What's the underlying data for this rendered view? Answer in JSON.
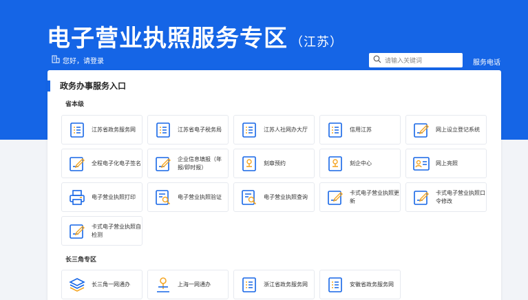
{
  "header": {
    "title": "电子营业执照服务专区",
    "subtitle": "（江苏）",
    "login_text": "您好，请登录",
    "hotline": "服务电话"
  },
  "search": {
    "placeholder": "请输入关键词"
  },
  "panel": {
    "title": "政务办事服务入口",
    "sections": [
      {
        "label": "省本级",
        "cards": [
          {
            "label": "江苏省政务服务网",
            "icon": "list-doc-icon"
          },
          {
            "label": "江苏省电子税务局",
            "icon": "list-doc-icon"
          },
          {
            "label": "江苏人社网办大厅",
            "icon": "list-doc-icon"
          },
          {
            "label": "信用江苏",
            "icon": "list-doc-icon"
          },
          {
            "label": "网上设立登记系统",
            "icon": "edit-doc-icon"
          },
          {
            "label": "全程电子化电子签名",
            "icon": "edit-doc-icon"
          },
          {
            "label": "企业信息填报（年报/即时报）",
            "icon": "edit-doc-icon"
          },
          {
            "label": "刻章预约",
            "icon": "stamp-doc-icon"
          },
          {
            "label": "刻企中心",
            "icon": "stamp-doc-icon"
          },
          {
            "label": "网上亮照",
            "icon": "id-card-icon"
          },
          {
            "label": "电子营业执照打印",
            "icon": "printer-icon"
          },
          {
            "label": "电子营业执照验证",
            "icon": "search-doc-icon"
          },
          {
            "label": "电子营业执照查询",
            "icon": "search-doc-icon"
          },
          {
            "label": "卡式电子营业执照更新",
            "icon": "edit-doc-icon"
          },
          {
            "label": "卡式电子营业执照口令修改",
            "icon": "edit-doc-icon"
          },
          {
            "label": "卡式电子营业执照自检测",
            "icon": "edit-doc-icon"
          }
        ]
      },
      {
        "label": "长三角专区",
        "cards": [
          {
            "label": "长三角一网通办",
            "icon": "layers-icon"
          },
          {
            "label": "上海一网通办",
            "icon": "person-pin-icon"
          },
          {
            "label": "浙江省政务服务网",
            "icon": "list-doc-icon"
          },
          {
            "label": "安徽省政务服务网",
            "icon": "list-doc-icon"
          }
        ]
      }
    ]
  },
  "colors": {
    "primary": "#1565e6",
    "accent": "#f5a623"
  }
}
